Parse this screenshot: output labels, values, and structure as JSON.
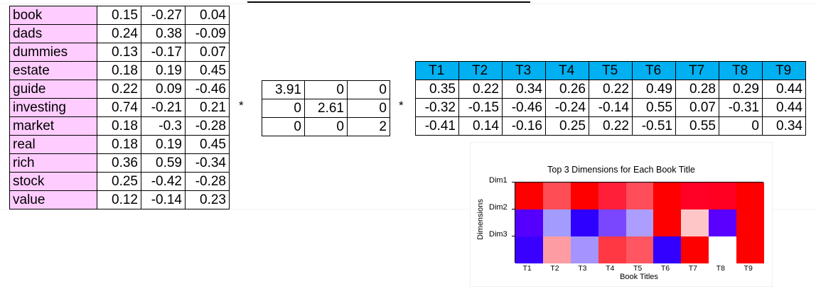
{
  "term_matrix": {
    "rows": [
      {
        "term": "book",
        "values": [
          "0.15",
          "-0.27",
          "0.04"
        ]
      },
      {
        "term": "dads",
        "values": [
          "0.24",
          "0.38",
          "-0.09"
        ]
      },
      {
        "term": "dummies",
        "values": [
          "0.13",
          "-0.17",
          "0.07"
        ]
      },
      {
        "term": "estate",
        "values": [
          "0.18",
          "0.19",
          "0.45"
        ]
      },
      {
        "term": "guide",
        "values": [
          "0.22",
          "0.09",
          "-0.46"
        ]
      },
      {
        "term": "investing",
        "values": [
          "0.74",
          "-0.21",
          "0.21"
        ]
      },
      {
        "term": "market",
        "values": [
          "0.18",
          "-0.3",
          "-0.28"
        ]
      },
      {
        "term": "real",
        "values": [
          "0.18",
          "0.19",
          "0.45"
        ]
      },
      {
        "term": "rich",
        "values": [
          "0.36",
          "0.59",
          "-0.34"
        ]
      },
      {
        "term": "stock",
        "values": [
          "0.25",
          "-0.42",
          "-0.28"
        ]
      },
      {
        "term": "value",
        "values": [
          "0.12",
          "-0.14",
          "0.23"
        ]
      }
    ]
  },
  "operators": {
    "first": "*",
    "second": "*"
  },
  "sigma_matrix": {
    "rows": [
      [
        "3.91",
        "0",
        "0"
      ],
      [
        "0",
        "2.61",
        "0"
      ],
      [
        "0",
        "0",
        "2"
      ]
    ]
  },
  "title_matrix": {
    "headers": [
      "T1",
      "T2",
      "T3",
      "T4",
      "T5",
      "T6",
      "T7",
      "T8",
      "T9"
    ],
    "header_color": "#00b0f0",
    "rows": [
      [
        "0.35",
        "0.22",
        "0.34",
        "0.26",
        "0.22",
        "0.49",
        "0.28",
        "0.29",
        "0.44"
      ],
      [
        "-0.32",
        "-0.15",
        "-0.46",
        "-0.24",
        "-0.14",
        "0.55",
        "0.07",
        "-0.31",
        "0.44"
      ],
      [
        "-0.41",
        "0.14",
        "-0.16",
        "0.25",
        "0.22",
        "-0.51",
        "0.55",
        "0",
        "0.34"
      ]
    ]
  },
  "heatmap": {
    "title": "Top 3 Dimensions for Each Book Title",
    "xlabel": "Book Titles",
    "ylabel": "Dimensions",
    "rows": [
      "Dim1",
      "Dim2",
      "Dim3"
    ],
    "cols": [
      "T1",
      "T2",
      "T3",
      "T4",
      "T5",
      "T6",
      "T7",
      "T8",
      "T9"
    ],
    "colors": [
      [
        "#ff0000",
        "#ff4d55",
        "#ff0000",
        "#ff1f38",
        "#ff4d5a",
        "#ff0000",
        "#ff0026",
        "#ff0022",
        "#ff0000"
      ],
      [
        "#5500ff",
        "#a39cff",
        "#2e00ff",
        "#7a47ff",
        "#ac9eff",
        "#ff0000",
        "#ffc6c8",
        "#5a00ff",
        "#ff0000"
      ],
      [
        "#3a00ff",
        "#ff9ca3",
        "#a593ff",
        "#ff3844",
        "#ff5662",
        "#3300ff",
        "#ff0000",
        "#ffffff",
        "#ff0000"
      ]
    ]
  }
}
